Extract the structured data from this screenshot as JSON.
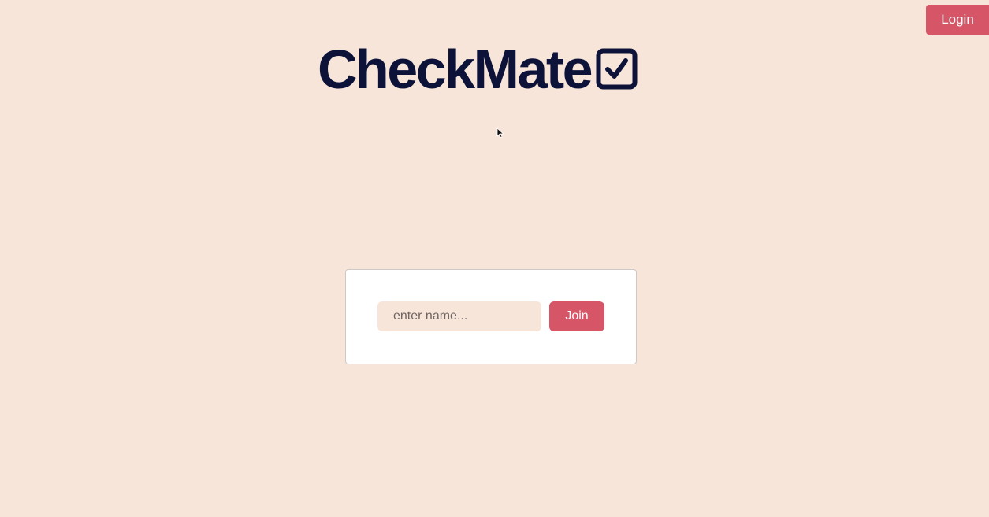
{
  "header": {
    "login_label": "Login"
  },
  "brand": {
    "name": "CheckMate",
    "icon": "checkbox-checked-icon"
  },
  "join_form": {
    "name_placeholder": "enter name...",
    "name_value": "",
    "join_label": "Join"
  },
  "colors": {
    "background": "#f8e5da",
    "accent": "#d65567",
    "brand_text": "#0c1238",
    "card": "#ffffff"
  }
}
